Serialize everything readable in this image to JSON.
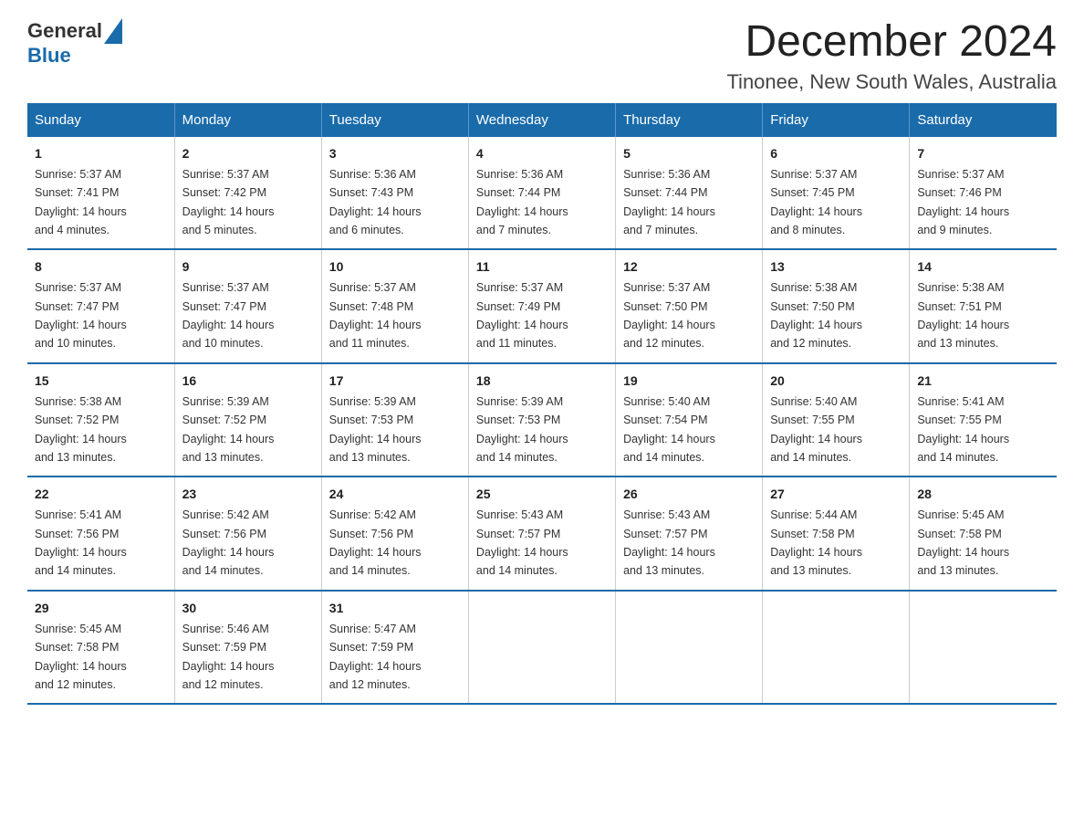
{
  "header": {
    "logo_general": "General",
    "logo_blue": "Blue",
    "month_title": "December 2024",
    "location": "Tinonee, New South Wales, Australia"
  },
  "days_of_week": [
    "Sunday",
    "Monday",
    "Tuesday",
    "Wednesday",
    "Thursday",
    "Friday",
    "Saturday"
  ],
  "weeks": [
    [
      {
        "day": "1",
        "sunrise": "5:37 AM",
        "sunset": "7:41 PM",
        "daylight": "14 hours and 4 minutes."
      },
      {
        "day": "2",
        "sunrise": "5:37 AM",
        "sunset": "7:42 PM",
        "daylight": "14 hours and 5 minutes."
      },
      {
        "day": "3",
        "sunrise": "5:36 AM",
        "sunset": "7:43 PM",
        "daylight": "14 hours and 6 minutes."
      },
      {
        "day": "4",
        "sunrise": "5:36 AM",
        "sunset": "7:44 PM",
        "daylight": "14 hours and 7 minutes."
      },
      {
        "day": "5",
        "sunrise": "5:36 AM",
        "sunset": "7:44 PM",
        "daylight": "14 hours and 7 minutes."
      },
      {
        "day": "6",
        "sunrise": "5:37 AM",
        "sunset": "7:45 PM",
        "daylight": "14 hours and 8 minutes."
      },
      {
        "day": "7",
        "sunrise": "5:37 AM",
        "sunset": "7:46 PM",
        "daylight": "14 hours and 9 minutes."
      }
    ],
    [
      {
        "day": "8",
        "sunrise": "5:37 AM",
        "sunset": "7:47 PM",
        "daylight": "14 hours and 10 minutes."
      },
      {
        "day": "9",
        "sunrise": "5:37 AM",
        "sunset": "7:47 PM",
        "daylight": "14 hours and 10 minutes."
      },
      {
        "day": "10",
        "sunrise": "5:37 AM",
        "sunset": "7:48 PM",
        "daylight": "14 hours and 11 minutes."
      },
      {
        "day": "11",
        "sunrise": "5:37 AM",
        "sunset": "7:49 PM",
        "daylight": "14 hours and 11 minutes."
      },
      {
        "day": "12",
        "sunrise": "5:37 AM",
        "sunset": "7:50 PM",
        "daylight": "14 hours and 12 minutes."
      },
      {
        "day": "13",
        "sunrise": "5:38 AM",
        "sunset": "7:50 PM",
        "daylight": "14 hours and 12 minutes."
      },
      {
        "day": "14",
        "sunrise": "5:38 AM",
        "sunset": "7:51 PM",
        "daylight": "14 hours and 13 minutes."
      }
    ],
    [
      {
        "day": "15",
        "sunrise": "5:38 AM",
        "sunset": "7:52 PM",
        "daylight": "14 hours and 13 minutes."
      },
      {
        "day": "16",
        "sunrise": "5:39 AM",
        "sunset": "7:52 PM",
        "daylight": "14 hours and 13 minutes."
      },
      {
        "day": "17",
        "sunrise": "5:39 AM",
        "sunset": "7:53 PM",
        "daylight": "14 hours and 13 minutes."
      },
      {
        "day": "18",
        "sunrise": "5:39 AM",
        "sunset": "7:53 PM",
        "daylight": "14 hours and 14 minutes."
      },
      {
        "day": "19",
        "sunrise": "5:40 AM",
        "sunset": "7:54 PM",
        "daylight": "14 hours and 14 minutes."
      },
      {
        "day": "20",
        "sunrise": "5:40 AM",
        "sunset": "7:55 PM",
        "daylight": "14 hours and 14 minutes."
      },
      {
        "day": "21",
        "sunrise": "5:41 AM",
        "sunset": "7:55 PM",
        "daylight": "14 hours and 14 minutes."
      }
    ],
    [
      {
        "day": "22",
        "sunrise": "5:41 AM",
        "sunset": "7:56 PM",
        "daylight": "14 hours and 14 minutes."
      },
      {
        "day": "23",
        "sunrise": "5:42 AM",
        "sunset": "7:56 PM",
        "daylight": "14 hours and 14 minutes."
      },
      {
        "day": "24",
        "sunrise": "5:42 AM",
        "sunset": "7:56 PM",
        "daylight": "14 hours and 14 minutes."
      },
      {
        "day": "25",
        "sunrise": "5:43 AM",
        "sunset": "7:57 PM",
        "daylight": "14 hours and 14 minutes."
      },
      {
        "day": "26",
        "sunrise": "5:43 AM",
        "sunset": "7:57 PM",
        "daylight": "14 hours and 13 minutes."
      },
      {
        "day": "27",
        "sunrise": "5:44 AM",
        "sunset": "7:58 PM",
        "daylight": "14 hours and 13 minutes."
      },
      {
        "day": "28",
        "sunrise": "5:45 AM",
        "sunset": "7:58 PM",
        "daylight": "14 hours and 13 minutes."
      }
    ],
    [
      {
        "day": "29",
        "sunrise": "5:45 AM",
        "sunset": "7:58 PM",
        "daylight": "14 hours and 12 minutes."
      },
      {
        "day": "30",
        "sunrise": "5:46 AM",
        "sunset": "7:59 PM",
        "daylight": "14 hours and 12 minutes."
      },
      {
        "day": "31",
        "sunrise": "5:47 AM",
        "sunset": "7:59 PM",
        "daylight": "14 hours and 12 minutes."
      },
      null,
      null,
      null,
      null
    ]
  ],
  "labels": {
    "sunrise": "Sunrise:",
    "sunset": "Sunset:",
    "daylight": "Daylight:"
  }
}
